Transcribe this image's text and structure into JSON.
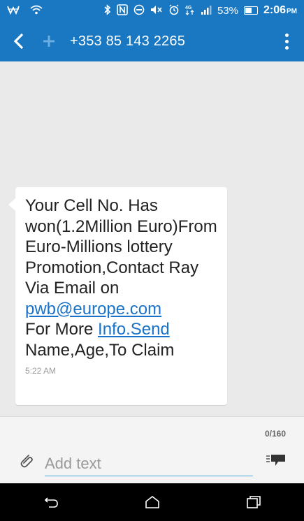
{
  "status_bar": {
    "battery": "53%",
    "time": "2:06",
    "ampm": "PM",
    "icons": [
      "wave-icon",
      "wifi-icon",
      "bluetooth-icon",
      "nfc-icon",
      "do-not-disturb-icon",
      "mute-icon",
      "alarm-icon",
      "data-4g-icon",
      "signal-icon",
      "battery-icon"
    ]
  },
  "app_bar": {
    "back_label": "<",
    "add_label": "+",
    "title": "+353 85 143 2265"
  },
  "message": {
    "line1": "Your Cell No. Has won(1.2Million Euro)From Euro-Millions lottery Promotion,Contact Ray Via Email on",
    "email": "pwb@europe.com",
    "line2_prefix": "For More",
    "info_link": "Info.Send",
    "line3": "Name,Age,To Claim",
    "time": "5:22 AM"
  },
  "composer": {
    "char_count": "0/160",
    "placeholder": "Add text"
  },
  "colors": {
    "app_bar": "#1a78c2",
    "background": "#eaeaea",
    "link": "#1a73c9",
    "input_underline": "#4aa8d8"
  }
}
